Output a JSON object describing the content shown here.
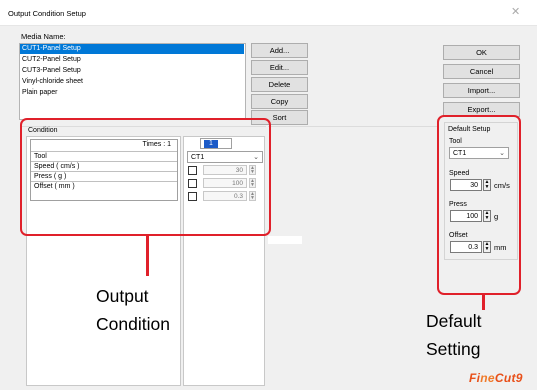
{
  "window": {
    "title": "Output Condition Setup",
    "close_icon": "close-icon"
  },
  "media": {
    "label": "Media Name:",
    "items": [
      {
        "label": "CUT1-Panel Setup",
        "selected": true
      },
      {
        "label": "CUT2-Panel Setup",
        "selected": false
      },
      {
        "label": "CUT3-Panel Setup",
        "selected": false
      },
      {
        "label": "Vinyl-chloride sheet",
        "selected": false
      },
      {
        "label": "Plain paper",
        "selected": false
      }
    ]
  },
  "media_buttons": {
    "add": "Add...",
    "edit": "Edit...",
    "delete": "Delete",
    "copy": "Copy",
    "sort": "Sort"
  },
  "right_buttons": {
    "ok": "OK",
    "cancel": "Cancel",
    "import": "Import...",
    "export": "Export..."
  },
  "condition": {
    "title": "Condition",
    "times_label": "Times : 1",
    "rows": [
      "Tool",
      "Speed ( cm/s )",
      "Press ( g )",
      "Offset ( mm )"
    ],
    "tab_number": "1",
    "tool_value": "CT1",
    "speed_value": "30",
    "press_value": "100",
    "offset_value": "0.3"
  },
  "default_setup": {
    "title": "Default Setup",
    "tool_label": "Tool",
    "tool_value": "CT1",
    "speed_label": "Speed",
    "speed_value": "30",
    "speed_unit": "cm/s",
    "press_label": "Press",
    "press_value": "100",
    "press_unit": "g",
    "offset_label": "Offset",
    "offset_value": "0.3",
    "offset_unit": "mm"
  },
  "annotations": {
    "output_condition": "Output\nCondition",
    "default_setting": "Default\nSetting",
    "color": "#e0202a"
  },
  "brand": {
    "logo_text": "FineCut9",
    "color": "#e8501a"
  },
  "colors": {
    "selection": "#0078d7",
    "tab_active": "#1c5bc7",
    "annotation": "#e0202a"
  }
}
